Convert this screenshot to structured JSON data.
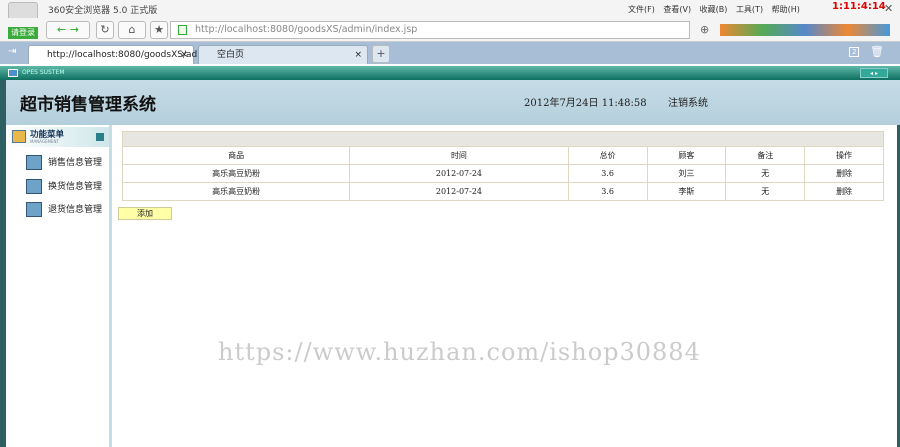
{
  "browser": {
    "title": "360安全浏览器 5.0 正式版",
    "login_label": "请登录",
    "url": "http://localhost:8080/goodsXS/admin/index.jsp",
    "menu": [
      "文件(F)",
      "查看(V)",
      "收藏(B)",
      "工具(T)",
      "帮助(H)"
    ],
    "clock": "1:11:4:14",
    "tabs": [
      {
        "label": "http://localhost:8080/goodsXS/ad..."
      },
      {
        "label": "空白页"
      }
    ],
    "tab_count": "2"
  },
  "banner": {
    "text": "OPES SUSTEM"
  },
  "header": {
    "title": "超市销售管理系统",
    "datetime": "2012年7月24日  11:48:58",
    "logout": "注销系统"
  },
  "sidebar": {
    "title": "功能菜单",
    "subtitle": "MANAGEMENT",
    "items": [
      {
        "label": "销售信息管理"
      },
      {
        "label": "换货信息管理"
      },
      {
        "label": "退货信息管理"
      }
    ]
  },
  "table": {
    "headers": [
      "商品",
      "时间",
      "总价",
      "顾客",
      "备注",
      "操作"
    ],
    "rows": [
      [
        "高乐高豆奶粉",
        "2012-07-24",
        "3.6",
        "刘三",
        "无",
        "删除"
      ],
      [
        "高乐高豆奶粉",
        "2012-07-24",
        "3.6",
        "李斯",
        "无",
        "删除"
      ]
    ]
  },
  "add_label": "添加",
  "watermark": "https://www.huzhan.com/ishop30884"
}
